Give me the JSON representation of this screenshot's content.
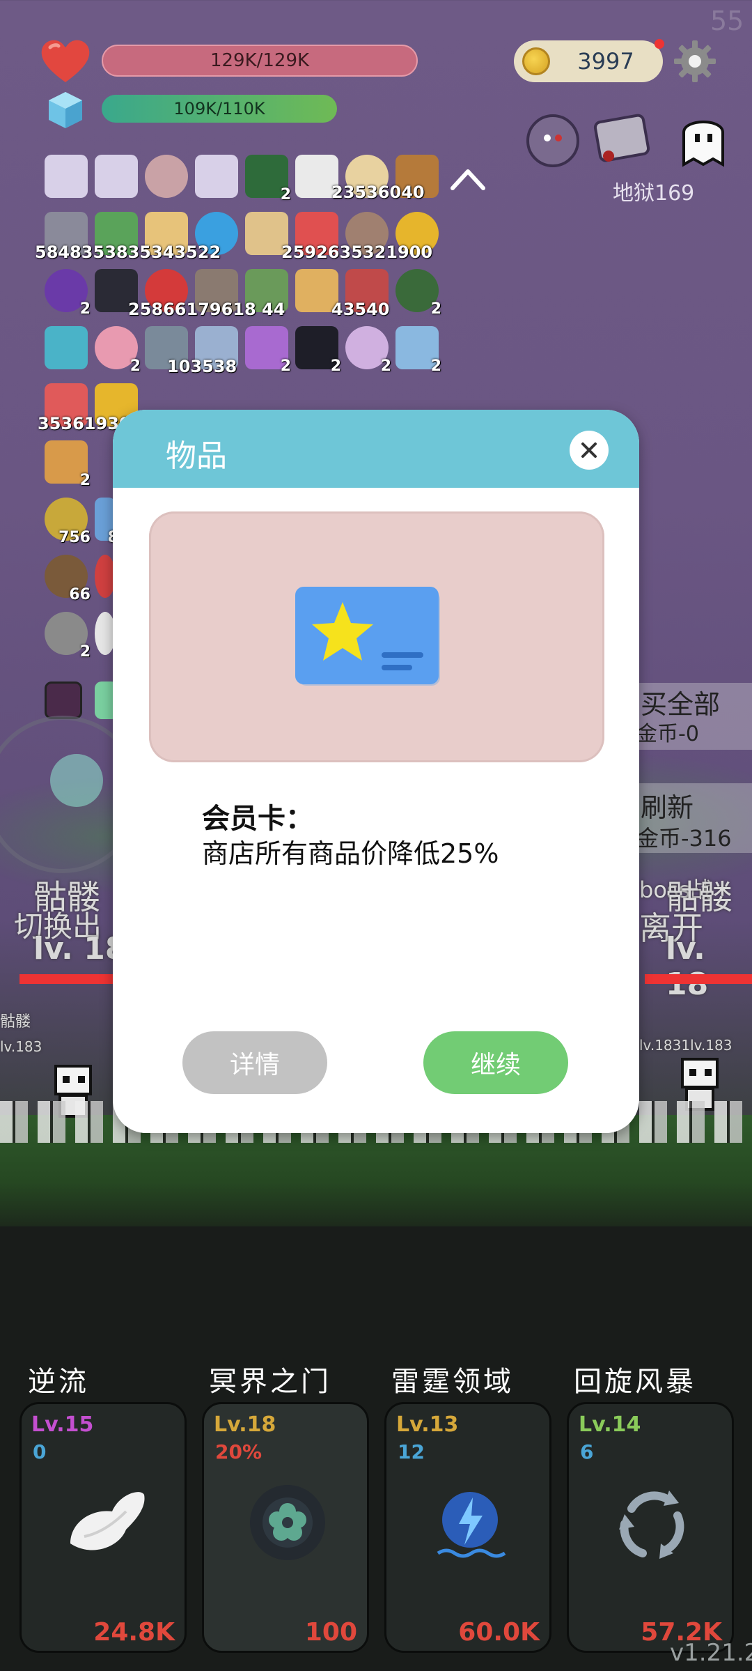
{
  "hud": {
    "hp_text": "129K/129K",
    "mp_text": "109K/110K",
    "coins": "3997",
    "fps": "55"
  },
  "hell": {
    "label": "地狱169"
  },
  "inventory": {
    "row1_counts": [
      "",
      "",
      "",
      "",
      "2",
      "",
      "23536",
      "040"
    ],
    "row1_overlay": "23536040",
    "row2_overlay": "5848353835343522",
    "row2_overlay_b": "2592635321900",
    "row3_counts": [
      "2",
      "",
      "",
      "",
      "",
      "",
      "",
      "2"
    ],
    "row3_overlay": "25866179618 44",
    "row3_overlay_b": "43540",
    "row4_counts": [
      "",
      "2",
      "",
      "",
      "2",
      "2",
      "2",
      "2"
    ],
    "row4_overlay": "103538",
    "row5_overlay": "35361930",
    "row6_counts": [
      "2",
      ""
    ],
    "row7_counts": [
      "756",
      "8"
    ],
    "row8_counts": [
      "66",
      ""
    ],
    "row9_counts": [
      "2",
      ""
    ]
  },
  "left_texts": {
    "skeleton_name": "骷髅",
    "switch_out": "切换出",
    "level": "lv. 18",
    "small_name": "骷髅",
    "small_level": "lv.183"
  },
  "right_panel": {
    "buy_all": "买全部",
    "buy_all_cost": "金币-0",
    "refresh": "刷新",
    "refresh_cost": "金币-316",
    "boss_text": "boss战",
    "skeleton_name": "骷髅",
    "leave": "离开",
    "level": "lv. 18",
    "small_level": "lv.1831lv.183"
  },
  "modal": {
    "title": "物品",
    "item_name": "会员卡：",
    "item_desc": "商店所有商品价降低25%",
    "btn_detail": "详情",
    "btn_continue": "继续"
  },
  "skills": [
    {
      "name": "逆流",
      "level": "Lv.15",
      "sub": "0",
      "cost": "24.8K",
      "level_color": "#c44fd0",
      "sub_color": "#4aa5d6",
      "icon": "wing-icon"
    },
    {
      "name": "冥界之门",
      "level": "Lv.18",
      "sub": "20%",
      "cost": "100",
      "level_color": "#d6a83a",
      "sub_color": "#e0483c",
      "icon": "portal-icon"
    },
    {
      "name": "雷霆领域",
      "level": "Lv.13",
      "sub": "12",
      "cost": "60.0K",
      "level_color": "#d6a83a",
      "sub_color": "#4aa5d6",
      "icon": "thunder-icon"
    },
    {
      "name": "回旋风暴",
      "level": "Lv.14",
      "sub": "6",
      "cost": "57.2K",
      "level_color": "#8acb5a",
      "sub_color": "#4aa5d6",
      "icon": "whirlwind-icon"
    }
  ],
  "version": "v1.21.2"
}
